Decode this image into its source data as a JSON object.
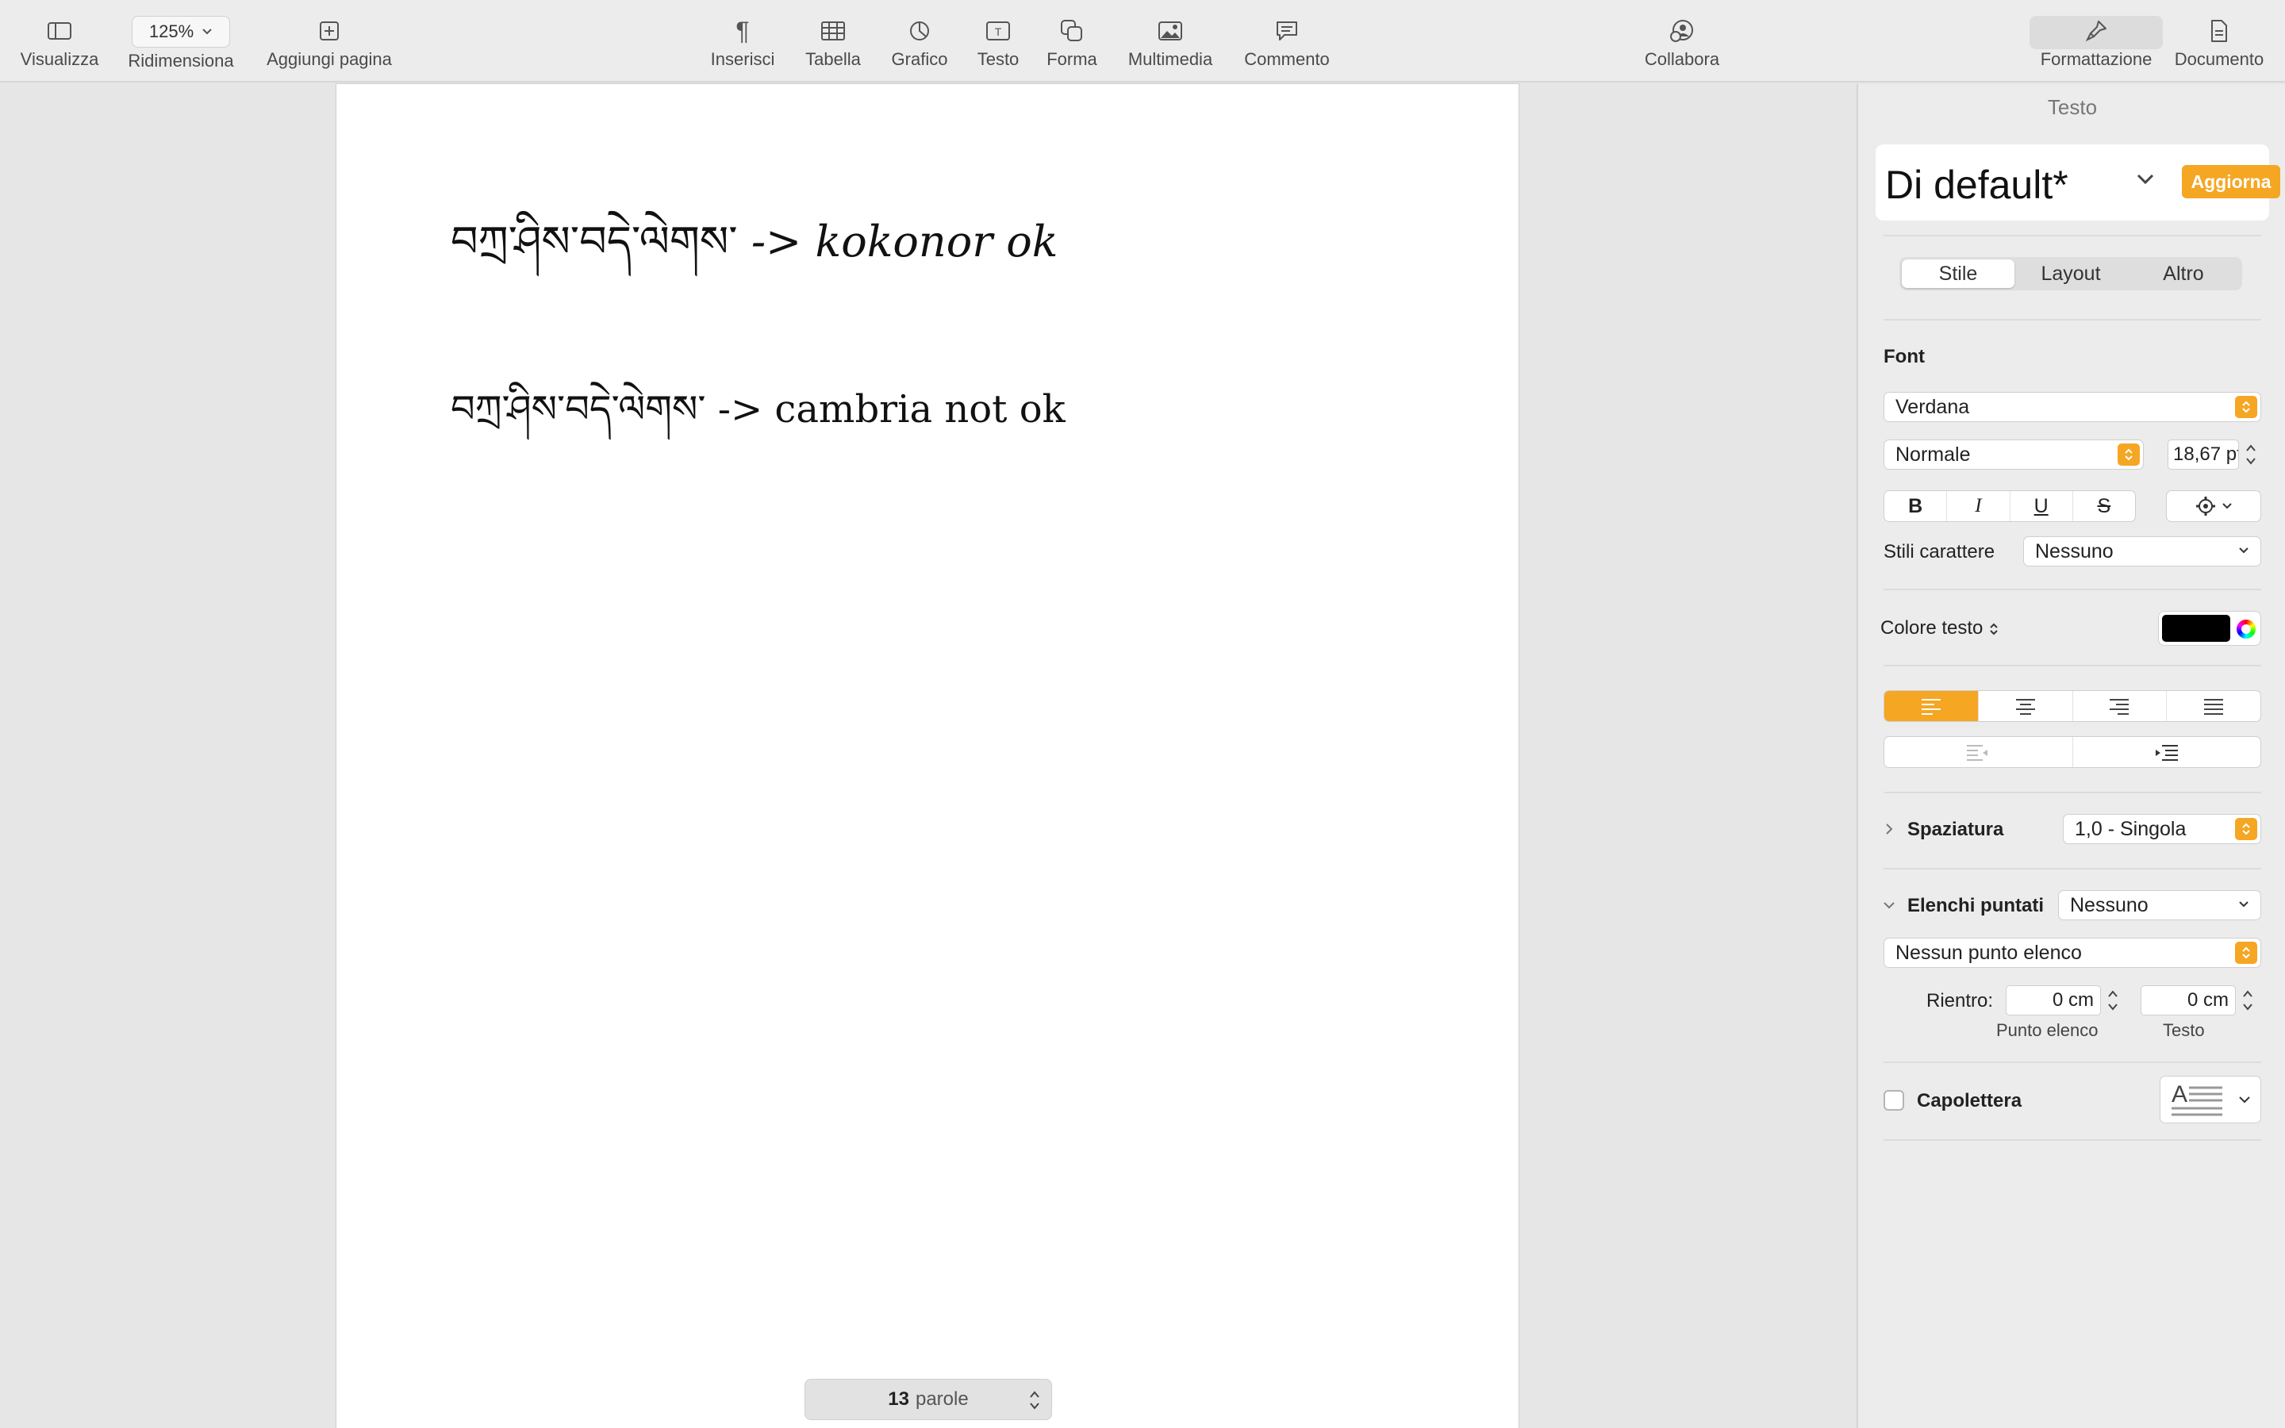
{
  "toolbar": {
    "visualizza": "Visualizza",
    "zoom_value": "125%",
    "ridimensiona": "Ridimensiona",
    "aggiungi_pagina": "Aggiungi pagina",
    "inserisci": "Inserisci",
    "tabella": "Tabella",
    "grafico": "Grafico",
    "testo": "Testo",
    "forma": "Forma",
    "multimedia": "Multimedia",
    "commento": "Commento",
    "collabora": "Collabora",
    "formattazione": "Formattazione",
    "documento": "Documento"
  },
  "document": {
    "line1_tibetan": "བཀྲ་ཤིས་བདེ་ལེགས་",
    "line1_latin": "-> kokonor ok",
    "line2_tibetan": "བཀྲ་ཤིས་བདེ་ལེགས་",
    "line2_latin": "-> cambria not ok"
  },
  "word_count": {
    "count": "13",
    "unit": "parole"
  },
  "sidebar": {
    "title": "Testo",
    "paragraph_style": "Di default*",
    "update_button": "Aggiorna",
    "tabs": [
      "Stile",
      "Layout",
      "Altro"
    ],
    "font_label": "Font",
    "font_family": "Verdana",
    "font_weight": "Normale",
    "font_size": "18,67 pt",
    "bold": "B",
    "italic": "I",
    "underline": "U",
    "strike": "S",
    "char_styles_label": "Stili carattere",
    "char_styles_value": "Nessuno",
    "text_color_label": "Colore testo",
    "text_color": "#000000",
    "spacing_label": "Spaziatura",
    "spacing_value": "1,0 - Singola",
    "bullets_label": "Elenchi puntati",
    "bullets_value": "Nessuno",
    "bullet_type": "Nessun punto elenco",
    "indent_label": "Rientro:",
    "indent_bullet_value": "0 cm",
    "indent_text_value": "0 cm",
    "indent_bullet_caption": "Punto elenco",
    "indent_text_caption": "Testo",
    "dropcap_label": "Capolettera"
  },
  "colors": {
    "accent": "#f5a623"
  }
}
